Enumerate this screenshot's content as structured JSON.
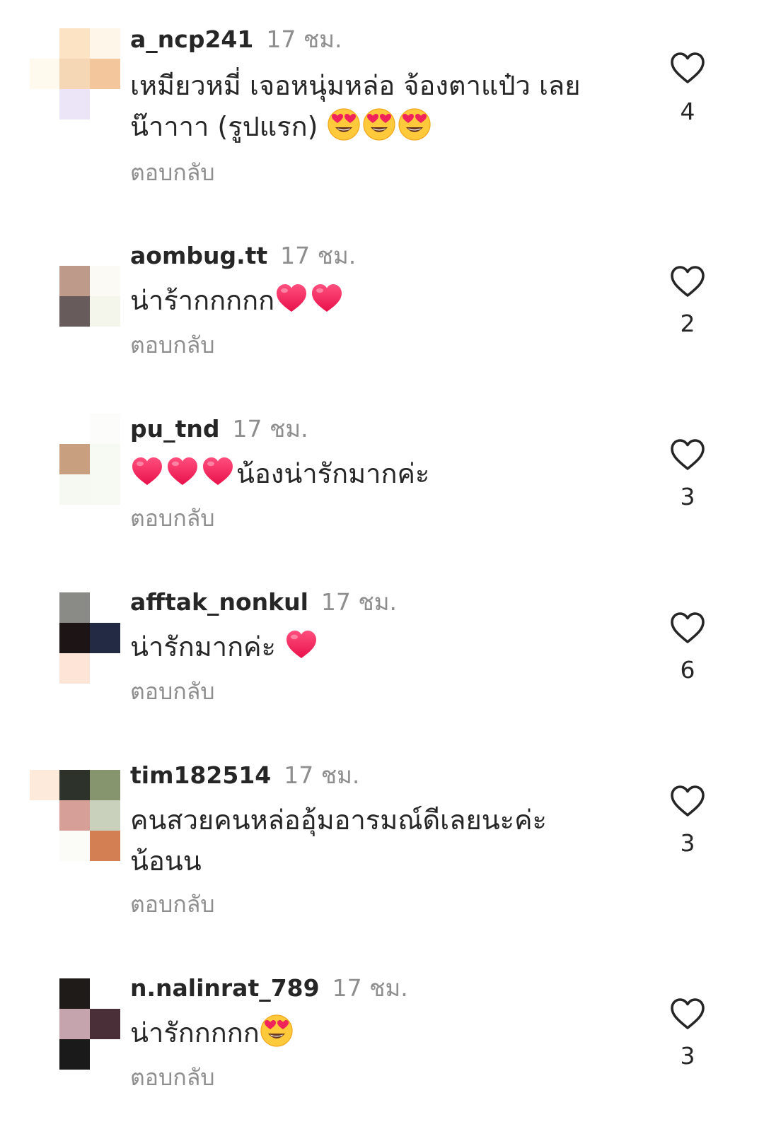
{
  "reply_label": "ตอบกลับ",
  "colors": {
    "text": "#262626",
    "muted": "#8e8e8e",
    "heart_outline": "#262626"
  },
  "comments": [
    {
      "username": "a_ncp241",
      "time": "17 ชม.",
      "lines": [
        {
          "text": "เหมียวหมี่ เจอหนุ่มหล่อ จ้องตาแป๋ว เลย",
          "emoji": []
        },
        {
          "text": "น๊าาาา (รูปแรก) ",
          "emoji": [
            "heart-eyes-emoji",
            "heart-eyes-emoji",
            "heart-eyes-emoji"
          ]
        }
      ],
      "likes": "4"
    },
    {
      "username": "aombug.tt",
      "time": "17 ชม.",
      "lines": [
        {
          "text": "น่าร้ากกกกก",
          "emoji": [
            "red-heart-emoji",
            "red-heart-emoji"
          ]
        }
      ],
      "likes": "2"
    },
    {
      "username": "pu_tnd",
      "time": "17 ชม.",
      "lines": [
        {
          "prefix_emoji": [
            "red-heart-emoji",
            "red-heart-emoji",
            "red-heart-emoji"
          ],
          "text": "น้องน่ารักมากค่ะ",
          "emoji": []
        }
      ],
      "likes": "3"
    },
    {
      "username": "afftak_nonkul",
      "time": "17 ชม.",
      "lines": [
        {
          "text": "น่ารักมากค่ะ ",
          "emoji": [
            "red-heart-emoji"
          ]
        }
      ],
      "likes": "6"
    },
    {
      "username": "tim182514",
      "time": "17 ชม.",
      "lines": [
        {
          "text": "คนสวยคนหล่ออุ้มอารมณ์ดีเลยนะค่ะ",
          "emoji": []
        },
        {
          "text": "น้อนน",
          "emoji": []
        }
      ],
      "likes": "3"
    },
    {
      "username": "n.nalinrat_789",
      "time": "17 ชม.",
      "lines": [
        {
          "text": "น่ารักกกกก",
          "emoji": [
            "heart-eyes-emoji"
          ]
        }
      ],
      "likes": "3"
    }
  ]
}
